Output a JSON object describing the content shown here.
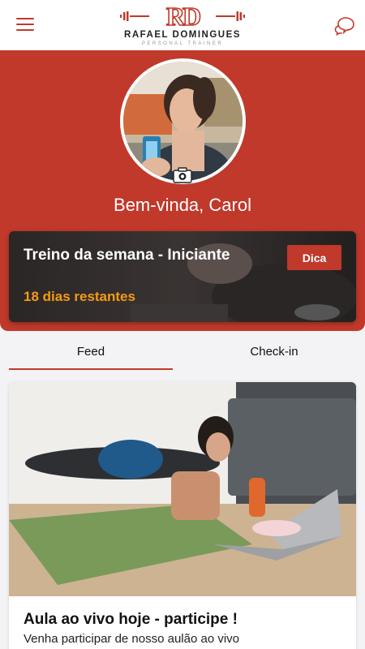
{
  "header": {
    "logo_mark": "RD",
    "logo_name": "RAFAEL DOMINGUES",
    "logo_subtitle": "PERSONAL TRAINER",
    "menu_icon": "hamburger-menu-icon",
    "chat_icon": "chat-bubbles-icon"
  },
  "profile": {
    "welcome": "Bem-vinda, Carol",
    "camera_icon": "camera-icon"
  },
  "week_card": {
    "title": "Treino da semana - Iniciante",
    "days_left": "18 dias restantes",
    "tip_button": "Dica"
  },
  "tabs": [
    {
      "label": "Feed",
      "active": true
    },
    {
      "label": "Check-in",
      "active": false
    }
  ],
  "feed": {
    "posts": [
      {
        "title": "Aula ao vivo hoje - participe !",
        "text": "Venha participar de nosso aulão ao vivo"
      }
    ]
  },
  "colors": {
    "brand_red": "#c0392b",
    "accent_orange": "#f39c12",
    "background": "#f3f3f5"
  }
}
